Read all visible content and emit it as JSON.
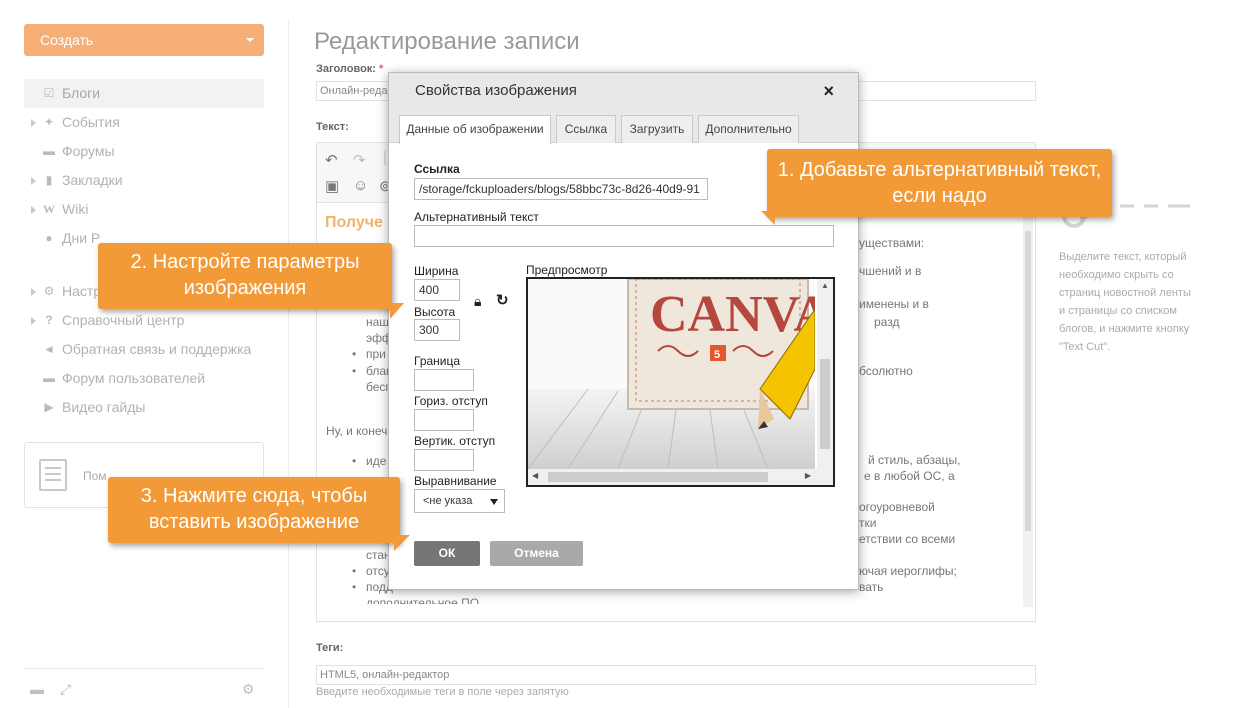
{
  "sidebar": {
    "create_label": "Создать",
    "items": [
      {
        "label": "Блоги",
        "icon": "edit-icon",
        "active": true
      },
      {
        "label": "События",
        "icon": "pin-icon"
      },
      {
        "label": "Форумы",
        "icon": "chat-icon"
      },
      {
        "label": "Закладки",
        "icon": "bookmark-icon"
      },
      {
        "label": "Wiki",
        "icon": "wiki-icon"
      },
      {
        "label": "Дни Р",
        "icon": "people-icon"
      },
      {
        "label": "Настр",
        "icon": "gear-icon"
      },
      {
        "label": "Справочный центр",
        "icon": "question-icon"
      },
      {
        "label": "Обратная связь и поддержка",
        "icon": "megaphone-icon"
      },
      {
        "label": "Форум пользователей",
        "icon": "chat-icon"
      },
      {
        "label": "Видео гайды",
        "icon": "video-icon"
      }
    ],
    "promo_text": "Пом"
  },
  "main": {
    "page_title": "Редактирование записи",
    "title_label": "Заголовок:",
    "title_required": "*",
    "title_value": "Онлайн-реда",
    "text_label": "Текст:",
    "editor_heading": "Получе",
    "editor_lines": [
      "уществами:",
      "чшений и в",
      "именены и в",
      "разд",
      "наш",
      "эфф",
      "при",
      "благ",
      "бесп",
      "бсолютно",
      "Ну, и конеч",
      "иде",
      "й стиль, абзацы,",
      "е в любой ОС, а",
      "огоуровневой",
      "тки",
      "етствии со всеми",
      "стан",
      "отсу",
      "ючая иероглифы;",
      "подд",
      "вать",
      "дополнительное ПО."
    ],
    "tags_label": "Теги:",
    "tags_value": "HTML5, онлайн-редактор",
    "tags_hint": "Введите необходимые теги в поле через запятую"
  },
  "right_panel": {
    "title": "t",
    "text": "Выделите текст, который необходимо скрыть со страниц новостной ленты и страницы со списком блогов, и нажмите кнопку \"Text Cut\"."
  },
  "dialog": {
    "title": "Свойства изображения",
    "close": "×",
    "tabs": [
      "Данные об изображении",
      "Ссылка",
      "Загрузить",
      "Дополнительно"
    ],
    "url_label": "Ссылка",
    "url_value": "/storage/fckuploaders/blogs/58bbc73c-8d26-40d9-91",
    "alt_label": "Альтернативный текст",
    "alt_value": "",
    "width_label": "Ширина",
    "width_value": "400",
    "height_label": "Высота",
    "height_value": "300",
    "border_label": "Граница",
    "hspace_label": "Гориз. отступ",
    "vspace_label": "Вертик. отступ",
    "align_label": "Выравнивание",
    "align_value": "<не указа",
    "preview_label": "Предпросмотр",
    "ok": "ОК",
    "cancel": "Отмена"
  },
  "callouts": [
    {
      "text": "1. Добавьте альтернативный текст, если надо"
    },
    {
      "text": "2. Настройте параметры изображения"
    },
    {
      "text": "3. Нажмите сюда, чтобы вставить изображение"
    }
  ],
  "colors": {
    "accent": "#f29a37",
    "create_button": "#f6ae77"
  }
}
